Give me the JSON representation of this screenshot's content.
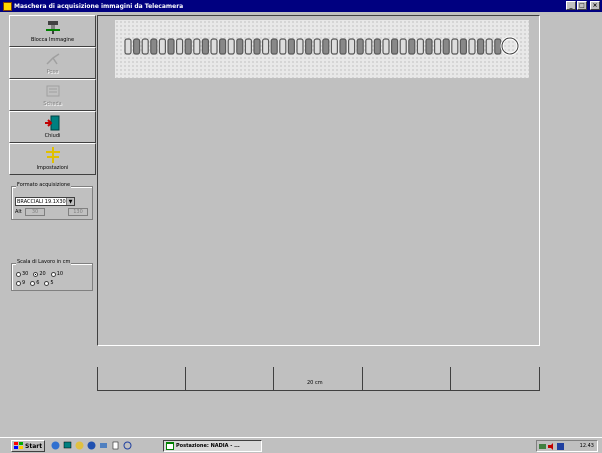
{
  "window": {
    "title": "Maschera di acquisizione immagini da Telecamera",
    "buttons": {
      "minimize": "_",
      "maximize": "□",
      "close": "×"
    }
  },
  "toolbar": {
    "items": [
      {
        "label": "Blocca Immagine",
        "icon": "camera-icon",
        "enabled": true
      },
      {
        "label": "Pose",
        "icon": "pose-icon",
        "enabled": false
      },
      {
        "label": "Scheda",
        "icon": "card-icon",
        "enabled": false
      },
      {
        "label": "Chiudi",
        "icon": "exit-door-icon",
        "enabled": true
      },
      {
        "label": "Impostazioni",
        "icon": "settings-icon",
        "enabled": true
      }
    ]
  },
  "acquisition_format": {
    "title": "Formato acquisizione",
    "selected": "BRACCIALI 19.1X30",
    "alt_label": "Alt",
    "alt_value_1": "30",
    "alt_value_2": "130"
  },
  "scale": {
    "title": "Scala di Lavoro in cm",
    "options_row1": [
      "30",
      "20",
      "10"
    ],
    "options_row2": [
      "9",
      "6",
      "5"
    ],
    "selected": "20"
  },
  "ruler": {
    "label": "20 cm"
  },
  "taskbar": {
    "start_label": "Start",
    "task_label": "Postazione: NADIA - ...",
    "clock": "12.43"
  },
  "colors": {
    "titlebar": "#000080",
    "face": "#c0c0c0",
    "chain": "#5a5a5a"
  }
}
